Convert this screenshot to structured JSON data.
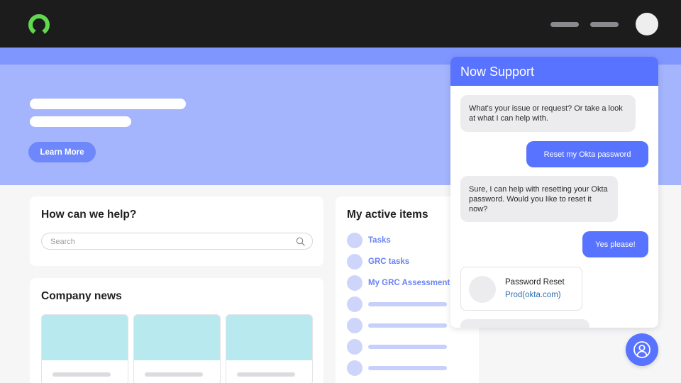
{
  "hero": {
    "cta_label": "Learn More"
  },
  "help": {
    "title": "How can we help?",
    "search_placeholder": "Search"
  },
  "news": {
    "title": "Company news"
  },
  "active_items": {
    "title": "My active items",
    "items": [
      {
        "label": "Tasks"
      },
      {
        "label": "GRC tasks"
      },
      {
        "label": "My GRC Assessments"
      }
    ]
  },
  "chat": {
    "title": "Now Support",
    "messages": [
      {
        "from": "bot",
        "text": "What's your issue or request? Or take a look at what I can help with."
      },
      {
        "from": "user",
        "text": "Reset my Okta password"
      },
      {
        "from": "bot",
        "text": "Sure, I can help with resetting your Okta password. Would you like to reset it now?"
      },
      {
        "from": "user",
        "text": "Yes please!"
      }
    ],
    "card": {
      "title": "Password Reset",
      "link": "Prod(okta.com)"
    }
  },
  "colors": {
    "topbar": "#1c1c1d",
    "logo": "#62d84e",
    "accent": "#5873ff",
    "hero": "#a5b5fd",
    "item_label": "#6c84f4"
  }
}
